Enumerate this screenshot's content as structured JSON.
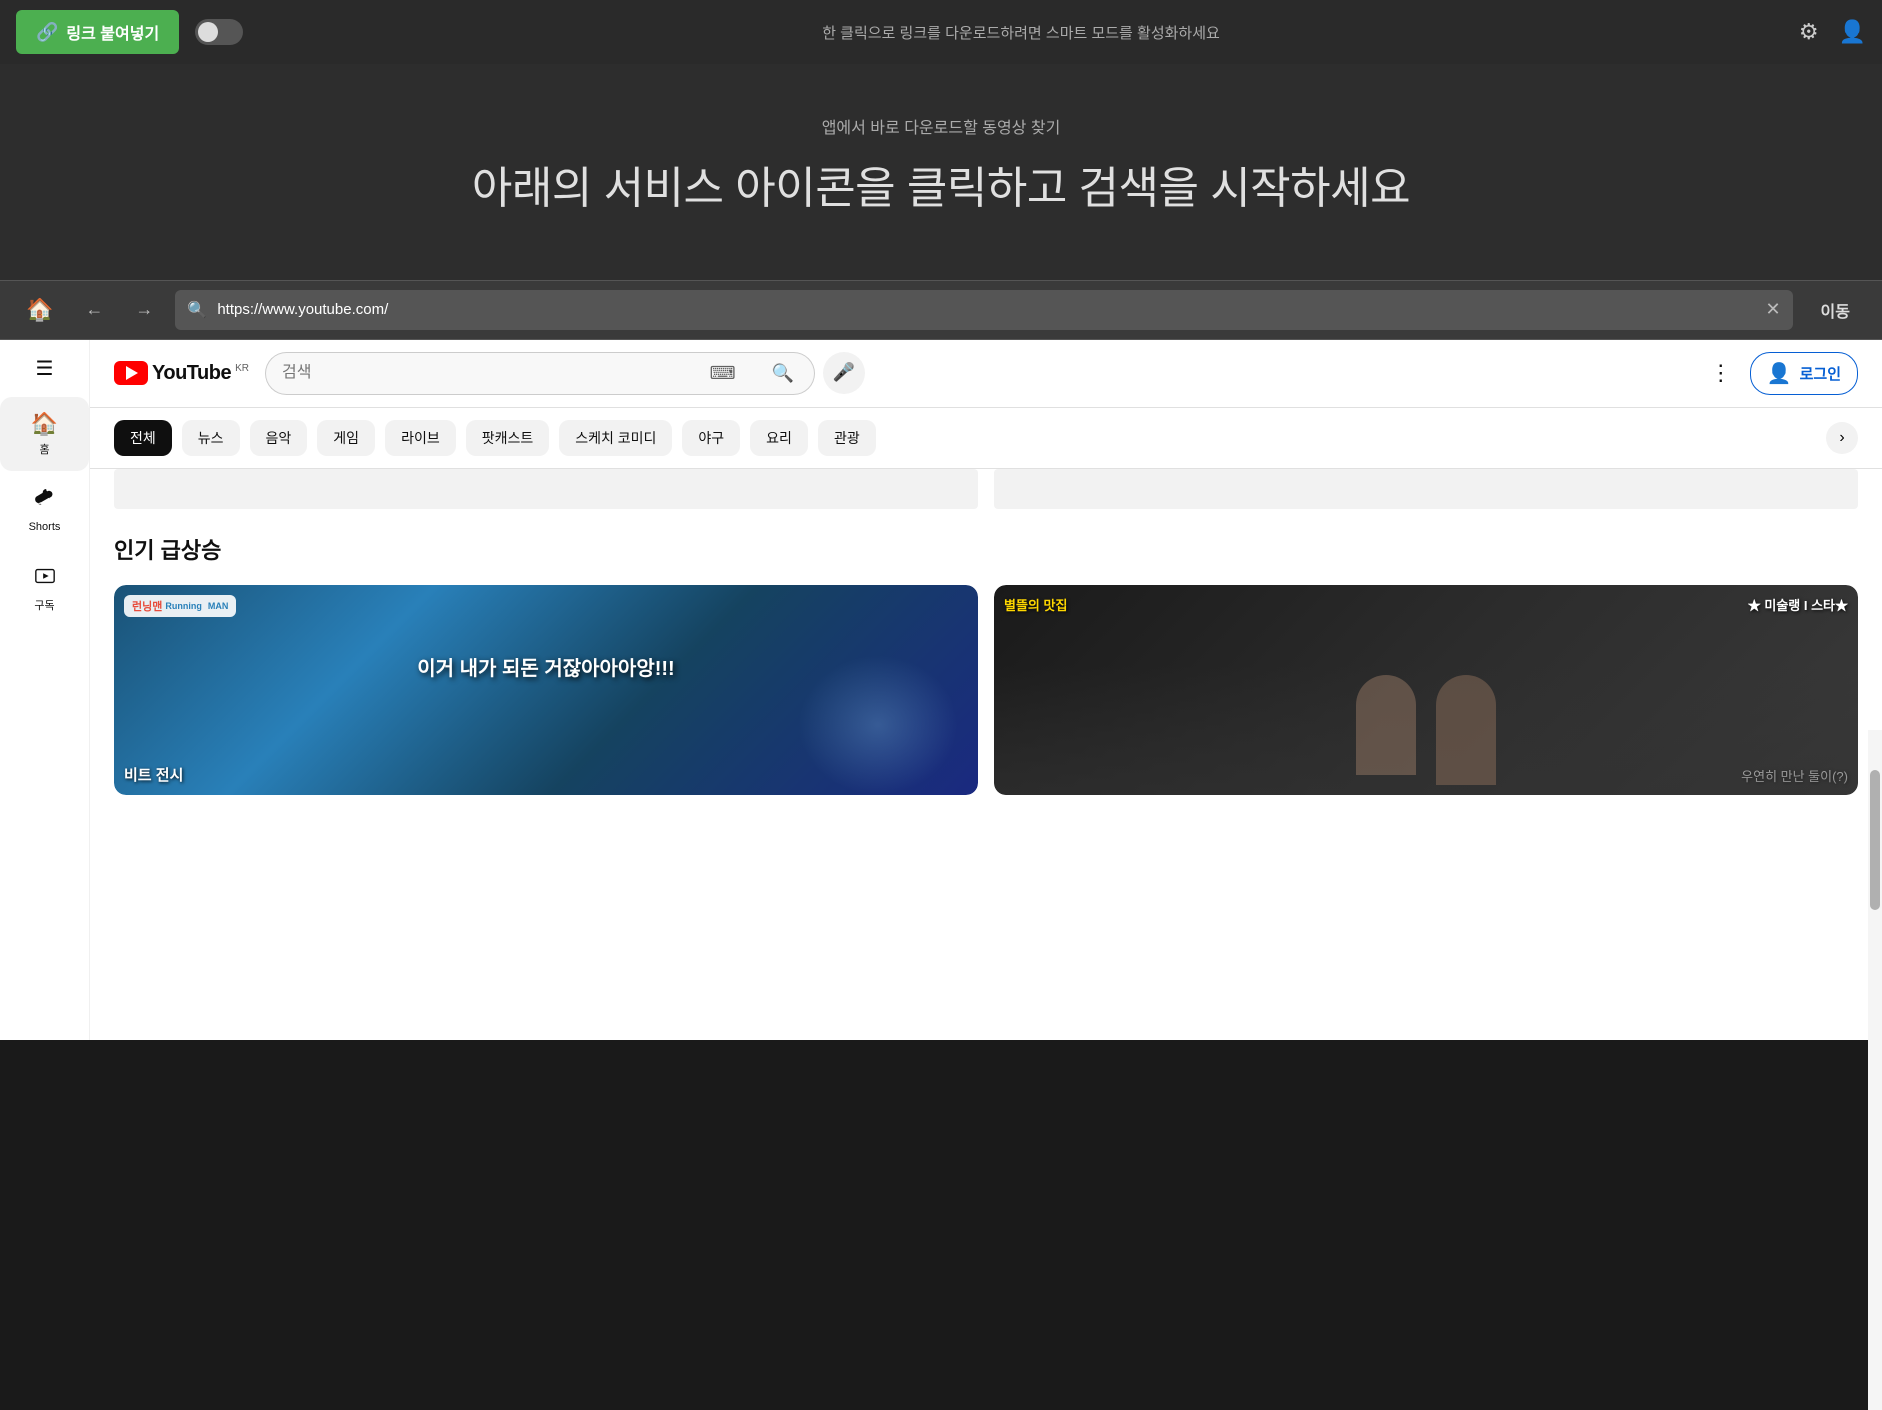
{
  "topBar": {
    "pasteButton": "링크 붙여넣기",
    "toggleDesc": "한 클릭으로 링크를 다운로드하려면 스마트 모드를 활성화하세요",
    "settingsIcon": "gear",
    "profileIcon": "user"
  },
  "hero": {
    "subtitle": "앱에서 바로 다운로드할 동영상 찾기",
    "title": "아래의 서비스 아이콘을 클릭하고 검색을 시작하세요"
  },
  "browserBar": {
    "url": "https://www.youtube.com/",
    "goLabel": "이동"
  },
  "youtube": {
    "logoText": "YouTube",
    "logoRegion": "KR",
    "searchPlaceholder": "검색",
    "loginLabel": "로그인",
    "filters": [
      {
        "label": "전체",
        "active": true
      },
      {
        "label": "뉴스",
        "active": false
      },
      {
        "label": "음악",
        "active": false
      },
      {
        "label": "게임",
        "active": false
      },
      {
        "label": "라이브",
        "active": false
      },
      {
        "label": "팟캐스트",
        "active": false
      },
      {
        "label": "스케치 코미디",
        "active": false
      },
      {
        "label": "야구",
        "active": false
      },
      {
        "label": "요리",
        "active": false
      },
      {
        "label": "관광",
        "active": false
      }
    ],
    "sidebar": {
      "home": {
        "icon": "🏠",
        "label": "홈"
      },
      "shorts": {
        "icon": "▶",
        "label": "Shorts"
      },
      "subscriptions": {
        "icon": "▶",
        "label": "구독"
      }
    },
    "trendingTitle": "인기 급상승",
    "videos": [
      {
        "title": "러닝맨",
        "centerText": "이거 내가\n되돈 거잖아아아앙!!!",
        "bottomText": "비트 전시",
        "thumb": "1"
      },
      {
        "topLeft": "별뜰의 맛집",
        "topRight": "★ 미술랭 I 스타★",
        "bottomRight": "우연히 만난 둘이(?)  ",
        "thumb": "2"
      }
    ]
  }
}
